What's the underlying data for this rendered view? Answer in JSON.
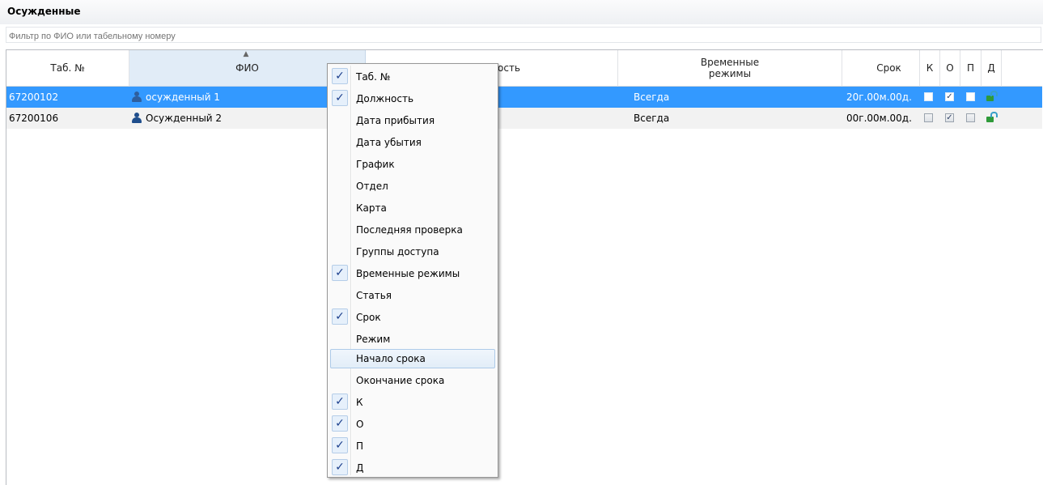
{
  "panel": {
    "title": "Осужденные"
  },
  "filter": {
    "placeholder": "Фильтр по ФИО или табельному номеру",
    "value": ""
  },
  "columns": {
    "tab": "Таб. №",
    "fio": "ФИО",
    "position_partial": "ость",
    "timemodes_line1": "Временные",
    "timemodes_line2": "режимы",
    "term": "Срок",
    "k": "К",
    "o": "О",
    "p": "П",
    "d": "Д"
  },
  "rows": [
    {
      "tab": "67200102",
      "fio": "осужденный 1",
      "timemodes": "Всегда",
      "term": "20г.00м.00д.",
      "k": false,
      "o": true,
      "p": false,
      "selected": true
    },
    {
      "tab": "67200106",
      "fio": "Осужденный 2",
      "timemodes": "Всегда",
      "term": "00г.00м.00д.",
      "k": false,
      "o": true,
      "p": false,
      "selected": false
    }
  ],
  "check_glyph": "✓",
  "box_check_glyph": "✓",
  "menu": {
    "items": [
      {
        "label": "Таб. №",
        "checked": true
      },
      {
        "label": "Должность",
        "checked": true
      },
      {
        "label": "Дата прибытия",
        "checked": false
      },
      {
        "label": "Дата убытия",
        "checked": false
      },
      {
        "label": "График",
        "checked": false
      },
      {
        "label": "Отдел",
        "checked": false
      },
      {
        "label": "Карта",
        "checked": false
      },
      {
        "label": "Последняя проверка",
        "checked": false
      },
      {
        "label": "Группы доступа",
        "checked": false
      },
      {
        "label": "Временные режимы",
        "checked": true
      },
      {
        "label": "Статья",
        "checked": false
      },
      {
        "label": "Срок",
        "checked": true
      },
      {
        "label": "Режим",
        "checked": false
      },
      {
        "label": "Начало срока",
        "checked": false,
        "hover": true
      },
      {
        "label": "Окончание срока",
        "checked": false
      },
      {
        "label": "К",
        "checked": true
      },
      {
        "label": "О",
        "checked": true
      },
      {
        "label": "П",
        "checked": true
      },
      {
        "label": "Д",
        "checked": true
      }
    ]
  },
  "colors": {
    "selection": "#3399ff",
    "header_sorted": "#e1ecf7",
    "check": "#1c3f8c"
  }
}
